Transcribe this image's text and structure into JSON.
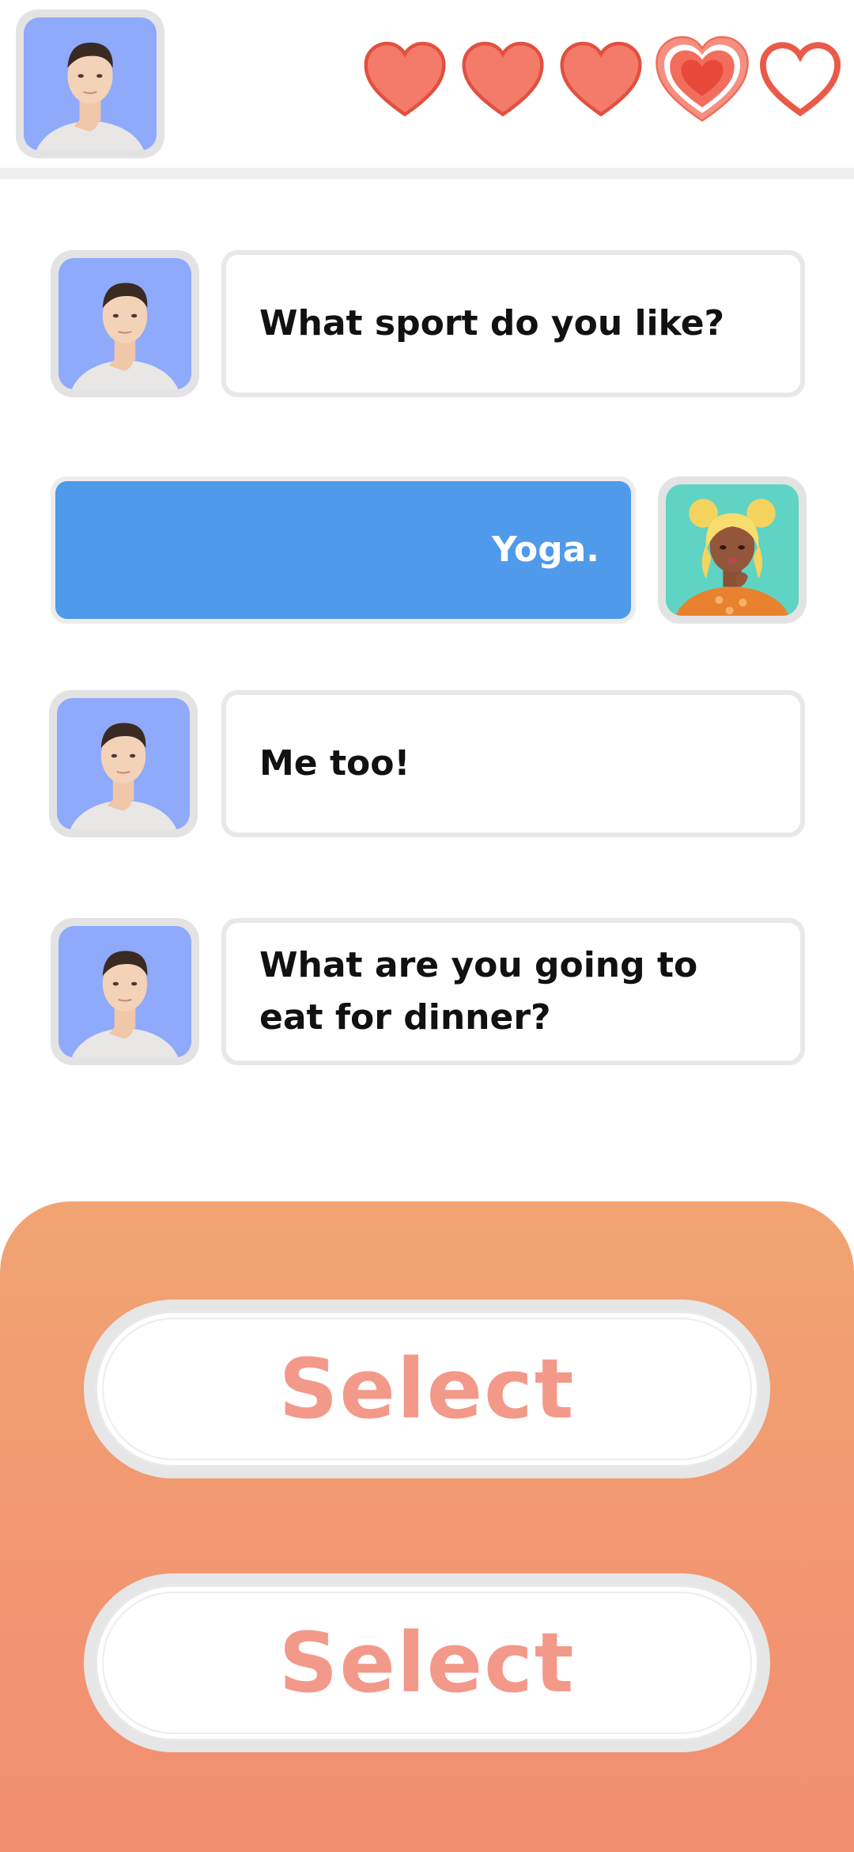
{
  "header": {
    "avatar_icon": "male-character-portrait",
    "hearts": [
      {
        "state": "filled"
      },
      {
        "state": "filled"
      },
      {
        "state": "filled"
      },
      {
        "state": "filling"
      },
      {
        "state": "empty"
      }
    ]
  },
  "chat": {
    "messages": [
      {
        "sender": "partner",
        "text": "What sport do you like?"
      },
      {
        "sender": "player",
        "text": "Yoga."
      },
      {
        "sender": "partner",
        "text": "Me too!"
      },
      {
        "sender": "partner",
        "text": "What are you going to\neat for dinner?"
      }
    ]
  },
  "choices": [
    {
      "label": "Select"
    },
    {
      "label": "Select"
    }
  ],
  "colors": {
    "heart_fill": "#f47b6a",
    "heart_stroke": "#e2503f",
    "player_bubble": "#4f9aea",
    "select_text": "#f3998a",
    "panel_top": "#f1a472",
    "panel_bottom": "#f28d72",
    "male_avatar_bg": "#8fa9fb",
    "female_avatar_bg": "#5fd3c4"
  }
}
